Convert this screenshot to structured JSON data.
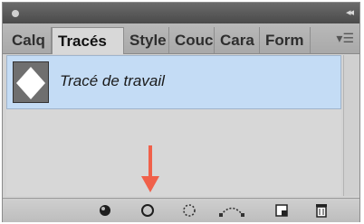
{
  "panel": {
    "tabs": [
      {
        "label": "Calq"
      },
      {
        "label": "Tracés"
      },
      {
        "label": "Style"
      },
      {
        "label": "Couc"
      },
      {
        "label": "Cara"
      },
      {
        "label": "Form"
      }
    ],
    "active_tab": "Tracés",
    "paths": [
      {
        "name": "Tracé de travail",
        "selected": true
      }
    ],
    "toolbar_icons": [
      "fill-path-icon",
      "stroke-path-icon",
      "load-selection-icon",
      "make-work-path-icon",
      "new-path-icon",
      "delete-path-icon"
    ],
    "annotation": {
      "arrow_color": "#f0604a",
      "target": "stroke-path-icon"
    }
  },
  "colors": {
    "selection": "#c4dcf5",
    "panel_bg": "#d7d7d7"
  }
}
